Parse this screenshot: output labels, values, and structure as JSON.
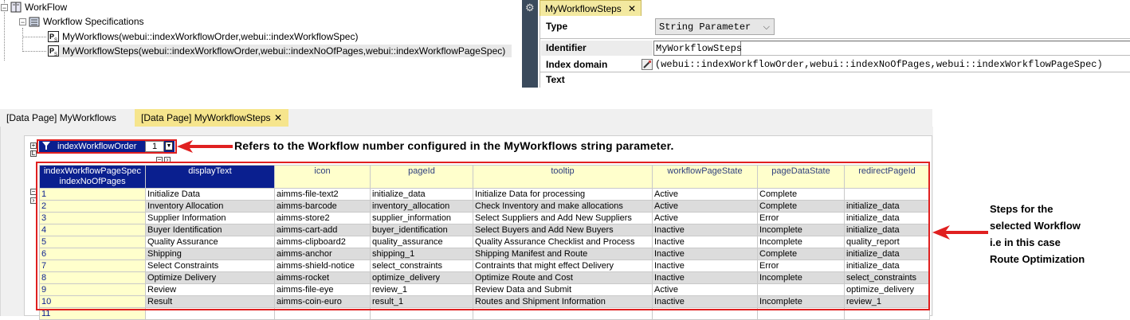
{
  "tree": {
    "root": "WorkFlow",
    "section": "Workflow Specifications",
    "items": [
      "MyWorkflows(webui::indexWorkflowOrder,webui::indexWorkflowSpec)",
      "MyWorkflowSteps(webui::indexWorkflowOrder,webui::indexNoOfPages,webui::indexWorkflowPageSpec)"
    ],
    "item_icon_label": "P S"
  },
  "attributes": {
    "tab_title": "MyWorkflowSteps",
    "tab_close": "✕",
    "type_label": "Type",
    "type_value": "String Parameter",
    "identifier_label": "Identifier",
    "identifier_value": "MyWorkflowSteps",
    "index_domain_label": "Index domain",
    "index_domain_value": "(webui::indexWorkflowOrder,webui::indexNoOfPages,webui::indexWorkflowPageSpec)",
    "text_label": "Text"
  },
  "datapages": {
    "tabs": [
      "[Data Page] MyWorkflows",
      "[Data Page] MyWorkflowSteps"
    ],
    "close": "✕"
  },
  "filter": {
    "label": "indexWorkflowOrder",
    "value": "1"
  },
  "grid": {
    "row_header_top": "indexWorkflowPageSpec",
    "row_header_bottom": "indexNoOfPages",
    "columns": [
      "displayText",
      "icon",
      "pageId",
      "tooltip",
      "workflowPageState",
      "pageDataState",
      "redirectPageId"
    ],
    "rows": [
      [
        "1",
        "Initialize Data",
        "aimms-file-text2",
        "initialize_data",
        "Initialize Data for processing",
        "Active",
        "Complete",
        ""
      ],
      [
        "2",
        "Inventory Allocation",
        "aimms-barcode",
        "inventory_allocation",
        "Check Inventory and make allocations",
        "Active",
        "Complete",
        "initialize_data"
      ],
      [
        "3",
        "Supplier Information",
        "aimms-store2",
        "supplier_information",
        "Select Suppliers and Add New Suppliers",
        "Active",
        "Error",
        "initialize_data"
      ],
      [
        "4",
        "Buyer Identification",
        "aimms-cart-add",
        "buyer_identification",
        "Select Buyers and Add New Buyers",
        "Inactive",
        "Incomplete",
        "initialize_data"
      ],
      [
        "5",
        "Quality Assurance",
        "aimms-clipboard2",
        "quality_assurance",
        "Quality Assurance Checklist and Process",
        "Inactive",
        "Incomplete",
        "quality_report"
      ],
      [
        "6",
        "Shipping",
        "aimms-anchor",
        "shipping_1",
        "Shipping Manifest and Route",
        "Inactive",
        "Complete",
        "initialize_data"
      ],
      [
        "7",
        "Select Constraints",
        "aimms-shield-notice",
        "select_constraints",
        "Contraints that might effect Delivery",
        "Inactive",
        "Error",
        "initialize_data"
      ],
      [
        "8",
        "Optimize Delivery",
        "aimms-rocket",
        "optimize_delivery",
        "Optimize Route and Cost",
        "Inactive",
        "Incomplete",
        "select_constraints"
      ],
      [
        "9",
        "Review",
        "aimms-file-eye",
        "review_1",
        "Review Data and Submit",
        "Active",
        "",
        "optimize_delivery"
      ],
      [
        "10",
        "Result",
        "aimms-coin-euro",
        "result_1",
        "Routes and Shipment Information",
        "Inactive",
        "Incomplete",
        "review_1"
      ],
      [
        "11",
        "",
        "",
        "",
        "",
        "",
        "",
        ""
      ]
    ]
  },
  "annotations": {
    "filter_note": "Refers to the Workflow number configured in the MyWorkflows string parameter.",
    "steps_note": [
      "Steps for the",
      "selected Workflow",
      "i.e in this case",
      "Route Optimization"
    ]
  },
  "colors": {
    "annotation": "#e02020",
    "header_navy": "#0a1f8f",
    "header_yellow": "#ffffcc"
  }
}
